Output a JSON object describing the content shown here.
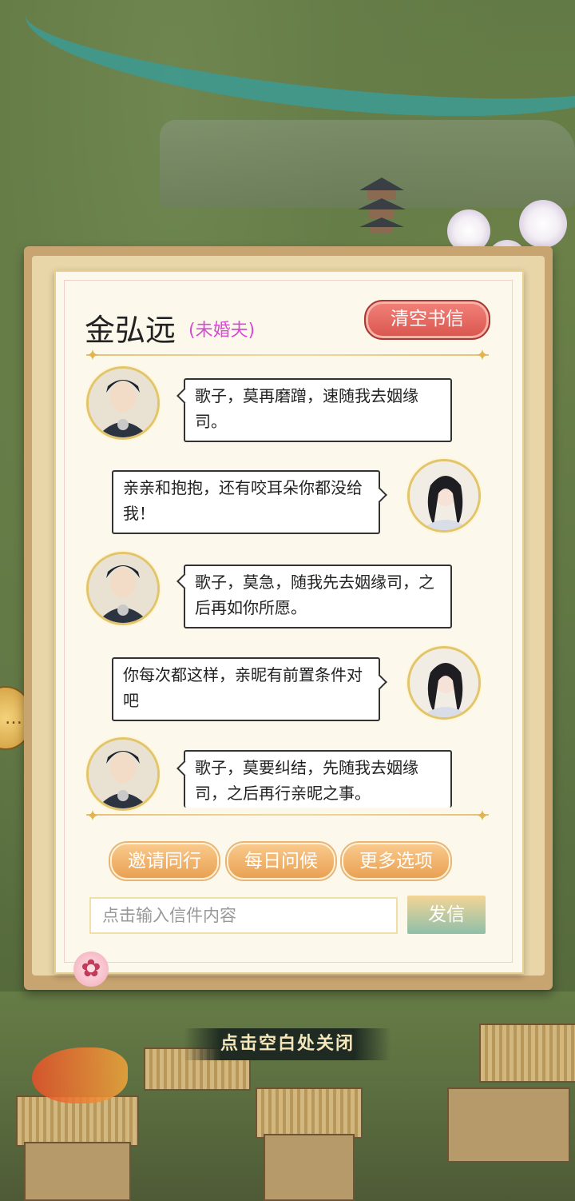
{
  "letter": {
    "name": "金弘远",
    "relation": "(未婚夫)",
    "clear_button": "清空书信"
  },
  "messages": [
    {
      "side": "left",
      "sender": "male",
      "text": "歌子，莫再磨蹭，速随我去姻缘司。"
    },
    {
      "side": "right",
      "sender": "female",
      "text": "亲亲和抱抱，还有咬耳朵你都没给我！"
    },
    {
      "side": "left",
      "sender": "male",
      "text": "歌子，莫急，随我先去姻缘司，之后再如你所愿。"
    },
    {
      "side": "right",
      "sender": "female",
      "text": "你每次都这样，亲昵有前置条件对吧"
    },
    {
      "side": "left",
      "sender": "male",
      "text": "歌子，莫要纠结，先随我去姻缘司，之后再行亲昵之事。"
    }
  ],
  "options": [
    "邀请同行",
    "每日问候",
    "更多选项"
  ],
  "composer": {
    "placeholder": "点击输入信件内容",
    "send_label": "发信"
  },
  "close_hint": "点击空白处关闭",
  "colors": {
    "relation": "#d54bd2",
    "clear_button": "#d9554d",
    "option_button": "#e9a154",
    "panel": "#fdf8ec"
  },
  "icons": [
    "male-avatar-icon",
    "female-avatar-icon",
    "chat-bubble-icon",
    "plum-blossom-icon",
    "sparkle-icon"
  ]
}
